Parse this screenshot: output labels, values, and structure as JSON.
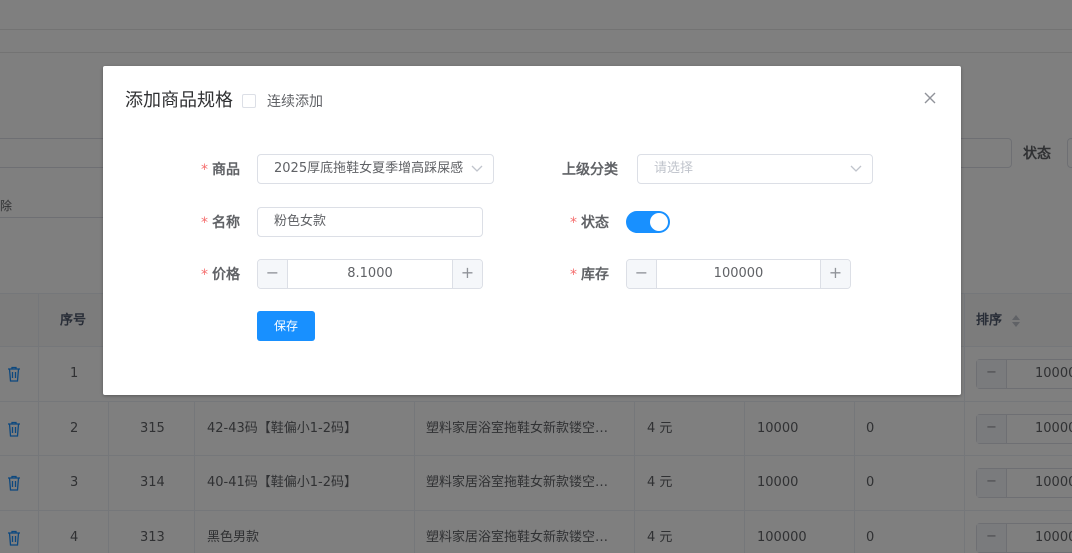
{
  "background": {
    "filter_status_label": "状态",
    "delete_fragment": "除",
    "table": {
      "headers": {
        "index": "序号",
        "sort": "排序"
      },
      "rows": [
        {
          "index": "1",
          "id": "",
          "name": "",
          "product": "",
          "price": "",
          "stock": "",
          "extra": "",
          "sort": "10000"
        },
        {
          "index": "2",
          "id": "315",
          "name": "42-43码【鞋偏小1-2码】",
          "product": "塑料家居浴室拖鞋女新款镂空…",
          "price": "4 元",
          "stock": "10000",
          "extra": "0",
          "sort": "10000"
        },
        {
          "index": "3",
          "id": "314",
          "name": "40-41码【鞋偏小1-2码】",
          "product": "塑料家居浴室拖鞋女新款镂空…",
          "price": "4 元",
          "stock": "10000",
          "extra": "0",
          "sort": "10000"
        },
        {
          "index": "4",
          "id": "313",
          "name": "黑色男款",
          "product": "塑料家居浴室拖鞋女新款镂空…",
          "price": "4 元",
          "stock": "100000",
          "extra": "0",
          "sort": "10000"
        }
      ]
    }
  },
  "dialog": {
    "title": "添加商品规格",
    "continuous_add_label": "连续添加",
    "continuous_add_checked": false,
    "form": {
      "product_label": "商品",
      "product_value": "2025厚底拖鞋女夏季增高踩屎感",
      "parent_category_label": "上级分类",
      "parent_category_placeholder": "请选择",
      "name_label": "名称",
      "name_value": "粉色女款",
      "status_label": "状态",
      "status_on": true,
      "price_label": "价格",
      "price_value": "8.1000",
      "stock_label": "库存",
      "stock_value": "100000",
      "required_mark": "*"
    },
    "save_label": "保存",
    "accent_color": "#1890ff"
  }
}
